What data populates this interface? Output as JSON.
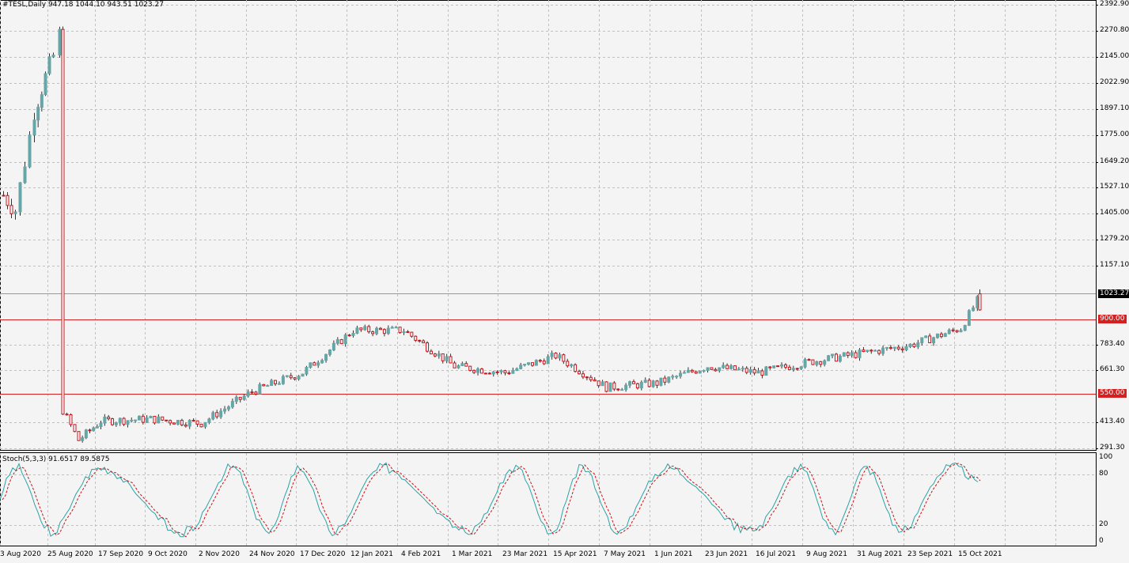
{
  "header": {
    "symbol_line": "#TESL,Daily  947.18 1044.10 943.51 1023.27",
    "stoch_line": "Stoch(5,3,3) 91.6517 89.5875"
  },
  "price_axis": {
    "ticks": [
      "2392.90",
      "2270.80",
      "2145.00",
      "2022.90",
      "1897.10",
      "1775.00",
      "1649.20",
      "1527.10",
      "1405.00",
      "1279.20",
      "1157.10",
      "783.40",
      "661.30",
      "413.40",
      "291.30"
    ]
  },
  "stoch_axis": {
    "ticks": [
      "100",
      "80",
      "20",
      "0"
    ]
  },
  "price_labels": {
    "current": "1023.27",
    "resistance": "900.00",
    "support": "550.00"
  },
  "time_axis": {
    "labels": [
      "3 Aug 2020",
      "25 Aug 2020",
      "17 Sep 2020",
      "9 Oct 2020",
      "2 Nov 2020",
      "24 Nov 2020",
      "17 Dec 2020",
      "12 Jan 2021",
      "4 Feb 2021",
      "1 Mar 2021",
      "23 Mar 2021",
      "15 Apr 2021",
      "7 May 2021",
      "1 Jun 2021",
      "23 Jun 2021",
      "16 Jul 2021",
      "9 Aug 2021",
      "31 Aug 2021",
      "23 Sep 2021",
      "15 Oct 2021"
    ]
  },
  "colors": {
    "background": "#f4f4f4",
    "grid": "#c0c0c0",
    "bull": "#66a6a6",
    "bear": "#c4161c",
    "level_line": "#d42020",
    "stoch_main": "#2aa4a4",
    "stoch_signal": "#c4161c"
  },
  "chart_data": {
    "type": "candlestick",
    "levels": [
      550,
      900
    ],
    "last_close": 1023.27,
    "stochastic": {
      "k": 91.6517,
      "d": 89.5875,
      "params": [
        5,
        3,
        3
      ]
    },
    "price_series": [
      {
        "x": "3 Aug 2020",
        "y": 1490
      },
      {
        "x": "10 Aug 2020",
        "y": 1420
      },
      {
        "x": "14 Aug 2020",
        "y": 1650
      },
      {
        "x": "19 Aug 2020",
        "y": 1890
      },
      {
        "x": "21 Aug 2020",
        "y": 2050
      },
      {
        "x": "25 Aug 2020",
        "y": 2150
      },
      {
        "x": "28 Aug 2020",
        "y": 2250
      },
      {
        "x": "1 Sep 2020",
        "y": 470
      },
      {
        "x": "8 Sep 2020",
        "y": 330
      },
      {
        "x": "17 Sep 2020",
        "y": 420
      },
      {
        "x": "9 Oct 2020",
        "y": 430
      },
      {
        "x": "2 Nov 2020",
        "y": 410
      },
      {
        "x": "24 Nov 2020",
        "y": 560
      },
      {
        "x": "17 Dec 2020",
        "y": 650
      },
      {
        "x": "12 Jan 2021",
        "y": 850
      },
      {
        "x": "4 Feb 2021",
        "y": 850
      },
      {
        "x": "1 Mar 2021",
        "y": 680
      },
      {
        "x": "23 Mar 2021",
        "y": 650
      },
      {
        "x": "15 Apr 2021",
        "y": 730
      },
      {
        "x": "7 May 2021",
        "y": 580
      },
      {
        "x": "1 Jun 2021",
        "y": 600
      },
      {
        "x": "23 Jun 2021",
        "y": 680
      },
      {
        "x": "16 Jul 2021",
        "y": 650
      },
      {
        "x": "9 Aug 2021",
        "y": 700
      },
      {
        "x": "31 Aug 2021",
        "y": 740
      },
      {
        "x": "23 Sep 2021",
        "y": 780
      },
      {
        "x": "15 Oct 2021",
        "y": 860
      },
      {
        "x": "22 Oct 2021",
        "y": 1023.27
      }
    ],
    "ylim": [
      291.3,
      2392.9
    ]
  }
}
